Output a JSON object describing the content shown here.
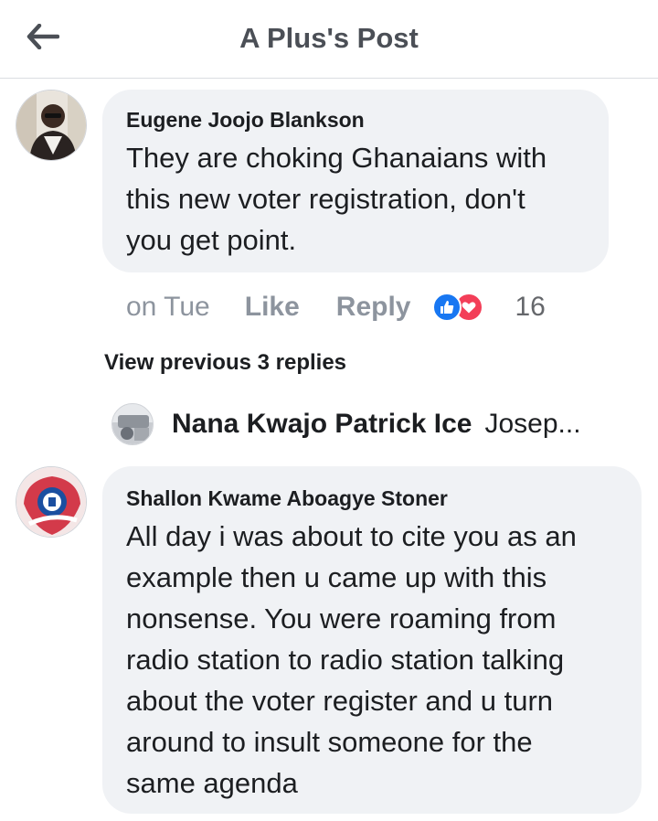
{
  "header": {
    "title": "A Plus's Post",
    "back_icon": "arrow-left-icon"
  },
  "comments": [
    {
      "author": "Eugene Joojo Blankson",
      "text_lines": [
        "They are choking Ghanaians with",
        "this new voter registration, don't",
        "you get point."
      ],
      "time": "on Tue",
      "like_label": "Like",
      "reply_label": "Reply",
      "reaction_count": "16",
      "reaction_icons": [
        "like-reaction-icon",
        "love-reaction-icon"
      ]
    },
    {
      "author": "Shallon Kwame Aboagye Stoner",
      "text_lines": [
        "All day i was about to cite you as an",
        "example then u came up with this",
        "nonsense. You were roaming from",
        "radio station to radio station talking",
        "about the voter register and u turn",
        "around to insult someone for the",
        "same agenda"
      ]
    }
  ],
  "view_previous_replies": "View previous 3 replies",
  "reply_preview": {
    "author": "Nana Kwajo Patrick Ice",
    "snippet": "Josep..."
  },
  "colors": {
    "bubble": "#f0f2f5",
    "like_blue": "#1877f2",
    "love_red": "#f33e58",
    "muted": "#8d949e"
  }
}
